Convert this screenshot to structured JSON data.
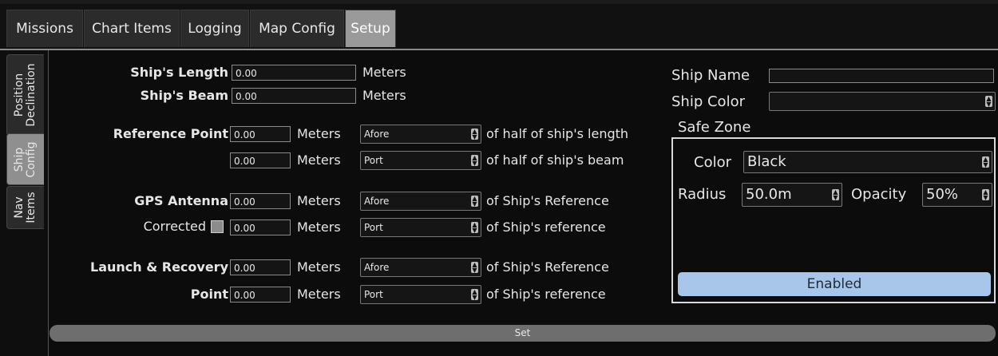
{
  "top_tabs": [
    {
      "label": "Missions"
    },
    {
      "label": "Chart Items"
    },
    {
      "label": "Logging"
    },
    {
      "label": "Map Config"
    },
    {
      "label": "Setup",
      "active": true
    }
  ],
  "side_tabs": [
    {
      "label_line1": "Position",
      "label_line2": "Declination"
    },
    {
      "label_line1": "Ship",
      "label_line2": "Config",
      "active": true
    },
    {
      "label_line1": "Nav",
      "label_line2": "Items"
    }
  ],
  "ship_length": {
    "label": "Ship's Length",
    "value": "0.00",
    "unit": "Meters"
  },
  "ship_beam": {
    "label": "Ship's Beam",
    "value": "0.00",
    "unit": "Meters"
  },
  "reference_point": {
    "label": "Reference Point",
    "row1": {
      "value": "0.00",
      "unit": "Meters",
      "direction": "Afore",
      "suffix": "of half of ship's length"
    },
    "row2": {
      "value": "0.00",
      "unit": "Meters",
      "direction": "Port",
      "suffix": "of half of ship's beam"
    }
  },
  "gps_antenna": {
    "label": "GPS Antenna",
    "row1": {
      "value": "0.00",
      "unit": "Meters",
      "direction": "Afore",
      "suffix": "of Ship's Reference"
    },
    "corrected_label": "Corrected",
    "row2": {
      "value": "0.00",
      "unit": "Meters",
      "direction": "Port",
      "suffix": "of Ship's reference"
    }
  },
  "launch_recovery": {
    "label1": "Launch & Recovery",
    "label2": "Point",
    "row1": {
      "value": "0.00",
      "unit": "Meters",
      "direction": "Afore",
      "suffix": "of Ship's Reference"
    },
    "row2": {
      "value": "0.00",
      "unit": "Meters",
      "direction": "Port",
      "suffix": "of Ship's reference"
    }
  },
  "ship_name": {
    "label": "Ship Name",
    "value": ""
  },
  "ship_color": {
    "label": "Ship Color",
    "value": ""
  },
  "safe_zone": {
    "title": "Safe Zone",
    "color_label": "Color",
    "color_value": "Black",
    "radius_label": "Radius",
    "radius_value": "50.0m",
    "opacity_label": "Opacity",
    "opacity_value": "50%",
    "enabled_label": "Enabled"
  },
  "set_label": "Set",
  "icons": {
    "spinner": "up-down-arrows-icon"
  },
  "colors": {
    "accent_button": "#a8c6e9",
    "active_tab": "#9a9a9a"
  }
}
